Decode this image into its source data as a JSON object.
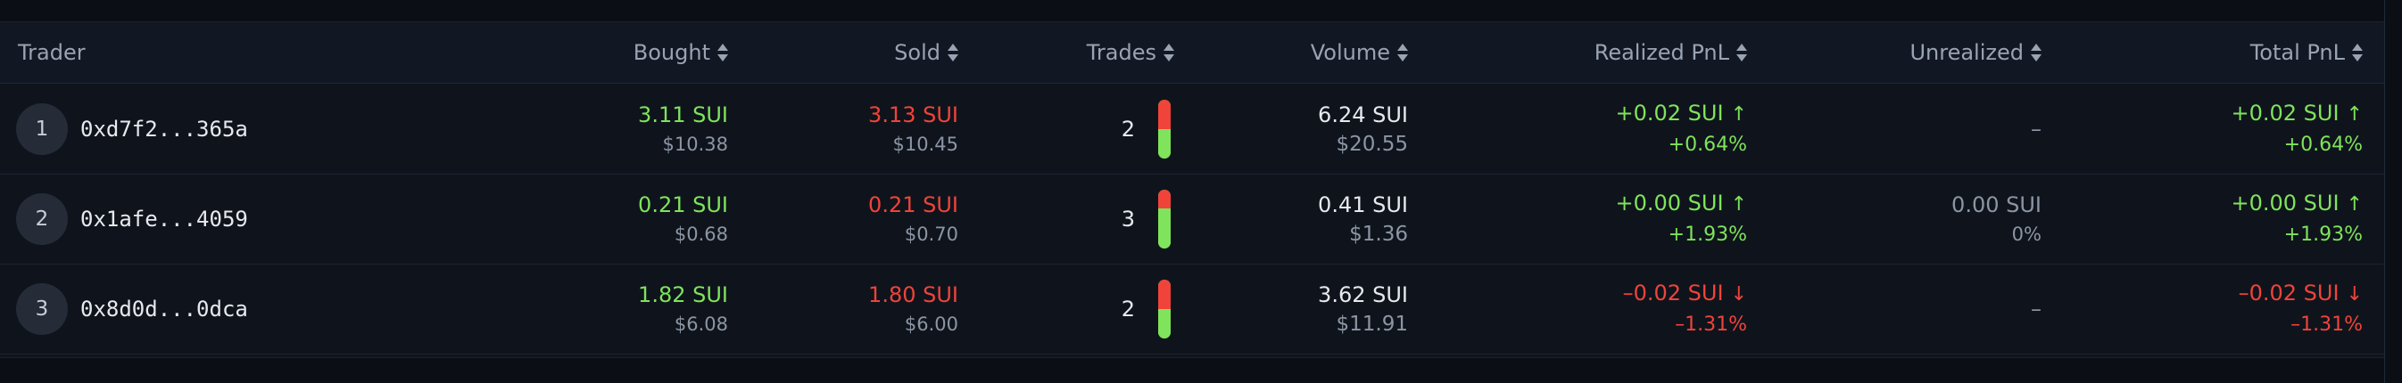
{
  "headers": {
    "trader": "Trader",
    "bought": "Bought",
    "sold": "Sold",
    "trades": "Trades",
    "volume": "Volume",
    "realized": "Realized PnL",
    "unrealized": "Unrealized",
    "total": "Total PnL"
  },
  "rows": [
    {
      "rank": "1",
      "trader": "0xd7f2...365a",
      "bought_sui": "3.11 SUI",
      "bought_usd": "$10.38",
      "sold_sui": "3.13 SUI",
      "sold_usd": "$10.45",
      "trades": "2",
      "sell_fraction": 0.5,
      "volume_sui": "6.24 SUI",
      "volume_usd": "$20.55",
      "realized_sui": "+0.02 SUI",
      "realized_pct": "+0.64%",
      "realized_dir": "up",
      "unrealized_sui": "–",
      "unrealized_pct": "",
      "total_sui": "+0.02 SUI",
      "total_pct": "+0.64%",
      "total_dir": "up"
    },
    {
      "rank": "2",
      "trader": "0x1afe...4059",
      "bought_sui": "0.21 SUI",
      "bought_usd": "$0.68",
      "sold_sui": "0.21 SUI",
      "sold_usd": "$0.70",
      "trades": "3",
      "sell_fraction": 0.33,
      "volume_sui": "0.41 SUI",
      "volume_usd": "$1.36",
      "realized_sui": "+0.00 SUI",
      "realized_pct": "+1.93%",
      "realized_dir": "up",
      "unrealized_sui": "0.00 SUI",
      "unrealized_pct": "0%",
      "total_sui": "+0.00 SUI",
      "total_pct": "+1.93%",
      "total_dir": "up"
    },
    {
      "rank": "3",
      "trader": "0x8d0d...0dca",
      "bought_sui": "1.82 SUI",
      "bought_usd": "$6.08",
      "sold_sui": "1.80 SUI",
      "sold_usd": "$6.00",
      "trades": "2",
      "sell_fraction": 0.5,
      "volume_sui": "3.62 SUI",
      "volume_usd": "$11.91",
      "realized_sui": "–0.02 SUI",
      "realized_pct": "–1.31%",
      "realized_dir": "down",
      "unrealized_sui": "–",
      "unrealized_pct": "",
      "total_sui": "–0.02 SUI",
      "total_pct": "–1.31%",
      "total_dir": "down"
    }
  ],
  "colors": {
    "positive": "#7fe35b",
    "negative": "#f0433a",
    "background": "#0f141c",
    "header": "#121823"
  },
  "icons": {
    "sort": "sort-icon",
    "up": "arrow-up-icon",
    "down": "arrow-down-icon"
  }
}
